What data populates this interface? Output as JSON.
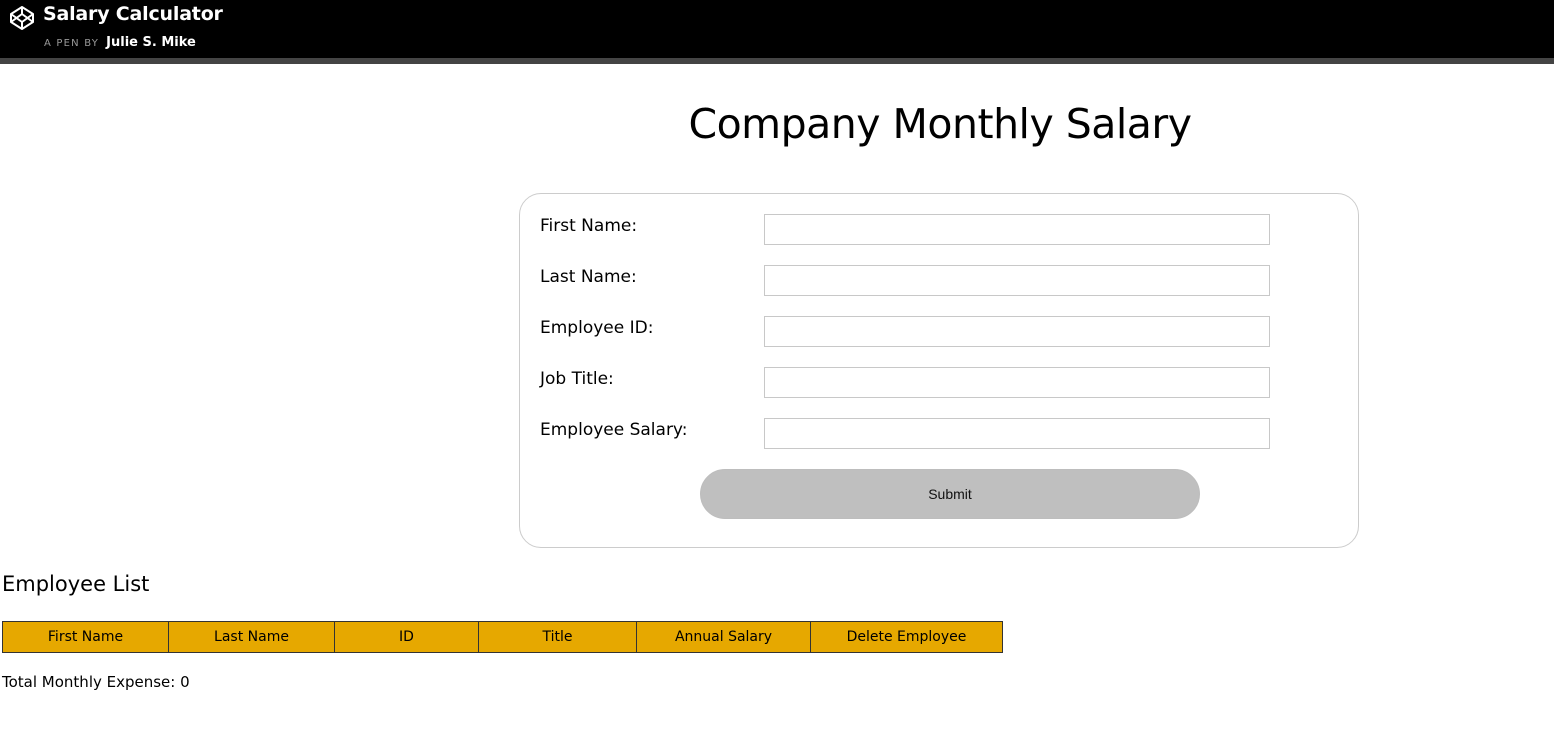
{
  "header": {
    "pen_title": "Salary Calculator",
    "byline_prefix": "A PEN BY",
    "author": "Julie S. Mike",
    "logo_icon": "codepen-logo-icon"
  },
  "page": {
    "title": "Company Monthly Salary"
  },
  "form": {
    "fields": [
      {
        "label": "First Name:",
        "value": "",
        "placeholder": ""
      },
      {
        "label": "Last Name:",
        "value": "",
        "placeholder": ""
      },
      {
        "label": "Employee ID:",
        "value": "",
        "placeholder": ""
      },
      {
        "label": "Job Title:",
        "value": "",
        "placeholder": ""
      },
      {
        "label": "Employee Salary:",
        "value": "",
        "placeholder": ""
      }
    ],
    "submit_label": "Submit"
  },
  "employee_list": {
    "title": "Employee List",
    "columns": [
      "First Name",
      "Last Name",
      "ID",
      "Title",
      "Annual Salary",
      "Delete Employee"
    ],
    "rows": [],
    "header_color": "#e6a800"
  },
  "footer": {
    "total_label": "Total Monthly Expense: 0"
  }
}
